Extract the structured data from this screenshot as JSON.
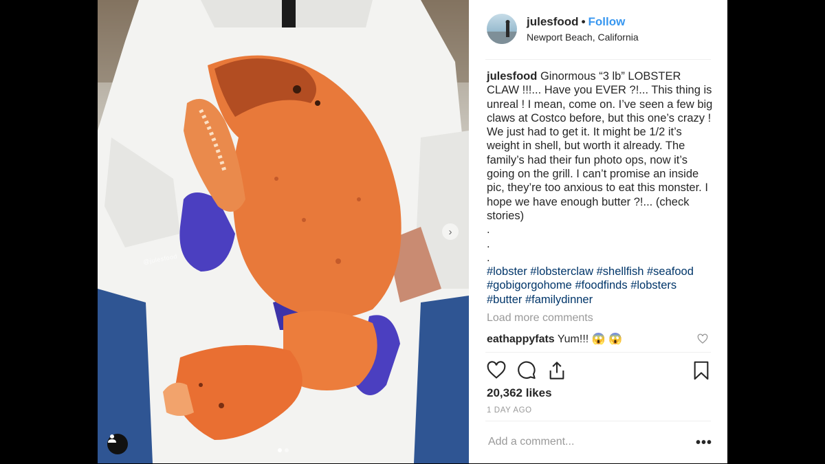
{
  "post": {
    "username": "julesfood",
    "separator": "•",
    "follow_label": "Follow",
    "location": "Newport Beach, California",
    "caption_user": "julesfood",
    "caption_text": "Ginormous “3 lb” LOBSTER CLAW !!!... Have you EVER ?!... This thing is unreal ! I mean, come on. I’ve seen a few big claws at Costco before, but this one’s crazy ! We just had to get it. It might be 1/2 it’s weight in shell, but worth it already. The family’s had their fun photo ops, now it’s going on the grill. I can’t promise an inside pic, they’re too anxious to eat this monster. I hope we have enough butter ?!... (check stories)\n.\n.\n.",
    "hashtags": [
      "#lobster",
      "#lobsterclaw",
      "#shellfish",
      "#seafood",
      "#gobigorgohome",
      "#foodfinds",
      "#lobsters",
      "#butter",
      "#familydinner"
    ],
    "load_more": "Load more comments",
    "comment_user": "eathappyfats",
    "comment_text": "Yum!!! 😱 😱",
    "likes": "20,362 likes",
    "time": "1 DAY AGO",
    "add_comment_placeholder": "Add a comment...",
    "more_label": "•••",
    "photo_watermark": "@julesfood",
    "carousel_dots": 2,
    "carousel_active": 1
  },
  "icons": {
    "like": "heart-icon",
    "comment": "comment-bubble-icon",
    "share": "share-icon",
    "save": "bookmark-icon",
    "next": "chevron-right-icon",
    "tagged": "user-icon"
  },
  "colors": {
    "link": "#3897f0",
    "hashtag": "#003569",
    "muted": "#999999",
    "claw": "#e8793a"
  }
}
